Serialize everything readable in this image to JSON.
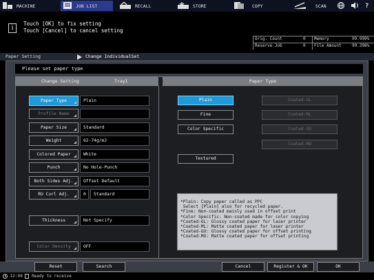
{
  "nav": {
    "tabs": [
      {
        "label": "MACHINE",
        "icon": "machine-icon"
      },
      {
        "label": "JOB LIST",
        "icon": "job-list-icon"
      },
      {
        "label": "RECALL",
        "icon": "recall-icon"
      },
      {
        "label": "STORE",
        "icon": "store-icon"
      },
      {
        "label": "COPY",
        "icon": "copy-icon"
      },
      {
        "label": "SCAN",
        "icon": "scan-icon"
      }
    ],
    "right_icons": [
      "globe-icon",
      "speaker-icon",
      "help-icon"
    ],
    "help_label": "?"
  },
  "message": {
    "line1": "Touch [OK] to fix setting",
    "line2": "Touch [Cancel] to cancel setting"
  },
  "counters": {
    "orig_count_label": "Orig. Count",
    "orig_count_value": "0",
    "memory_label": "Memory",
    "memory_value": "99.999%",
    "reserve_job_label": "Reserve Job",
    "reserve_job_value": "0",
    "file_amount_label": "File Amount",
    "file_amount_value": "99.398%"
  },
  "breadcrumb": {
    "parent": "Paper Setting",
    "current": "Change IndividualSet"
  },
  "prompt": "Please set paper type",
  "left": {
    "header_title": "Change Setting",
    "header_tray": "Tray1",
    "rows": [
      {
        "label": "Paper Type",
        "value": "Plain",
        "state": "active"
      },
      {
        "label": "Profile Name",
        "value": "",
        "state": "disabled"
      },
      {
        "label": "Paper Size",
        "value": "Standard",
        "state": "normal"
      },
      {
        "label": "Weight",
        "value": "62-74g/m2",
        "state": "normal"
      },
      {
        "label": "Colored Paper",
        "value": "White",
        "state": "normal"
      },
      {
        "label": "Punch",
        "value": "No Hole-Punch",
        "state": "normal"
      },
      {
        "label": "Both Sides Adj.",
        "value": "Offset Default",
        "state": "normal"
      },
      {
        "label": "RU Curl Adj.",
        "value": "0",
        "value2": "Standard",
        "state": "normal"
      },
      {
        "label": "Thickness",
        "value": "Not Specify",
        "state": "normal"
      },
      {
        "label": "Color Density",
        "value": "OFF",
        "state": "disabled"
      }
    ]
  },
  "right": {
    "header": "Paper Type",
    "options": [
      {
        "label": "Plain",
        "state": "active"
      },
      {
        "label": "Fine",
        "state": "normal"
      },
      {
        "label": "Color Specific",
        "state": "normal"
      },
      {
        "label": "Textured",
        "state": "normal"
      },
      {
        "label": "Coated-GL",
        "state": "disabled"
      },
      {
        "label": "Coated-ML",
        "state": "disabled"
      },
      {
        "label": "Coated-GO",
        "state": "disabled"
      },
      {
        "label": "Coated-MO",
        "state": "disabled"
      }
    ],
    "description": "*Plain: Copy paper called as PPC\n Select [Plain] also for recycled paper.\n*Fine: Non-coated mainly used in offset print\n*Color Specific: Non-coated made for color copying\n*Coated-GL: Glossy coated paper for laser printer\n*Coated-ML: Matte coated paper for laser printer\n*Coated-GO: Glossy coated paper for offset printing\n*Coated-MO: Matte coated paper for offset printing"
  },
  "bottom": {
    "reset": "Reset",
    "search": "Search",
    "cancel": "Cancel",
    "register_ok": "Register & OK",
    "ok": "OK"
  },
  "status": {
    "time": "12:09",
    "text": "Ready to receive"
  },
  "colors": {
    "accent": "#1f9ad8",
    "panel": "#3a3e46",
    "nav": "#0e1220"
  }
}
